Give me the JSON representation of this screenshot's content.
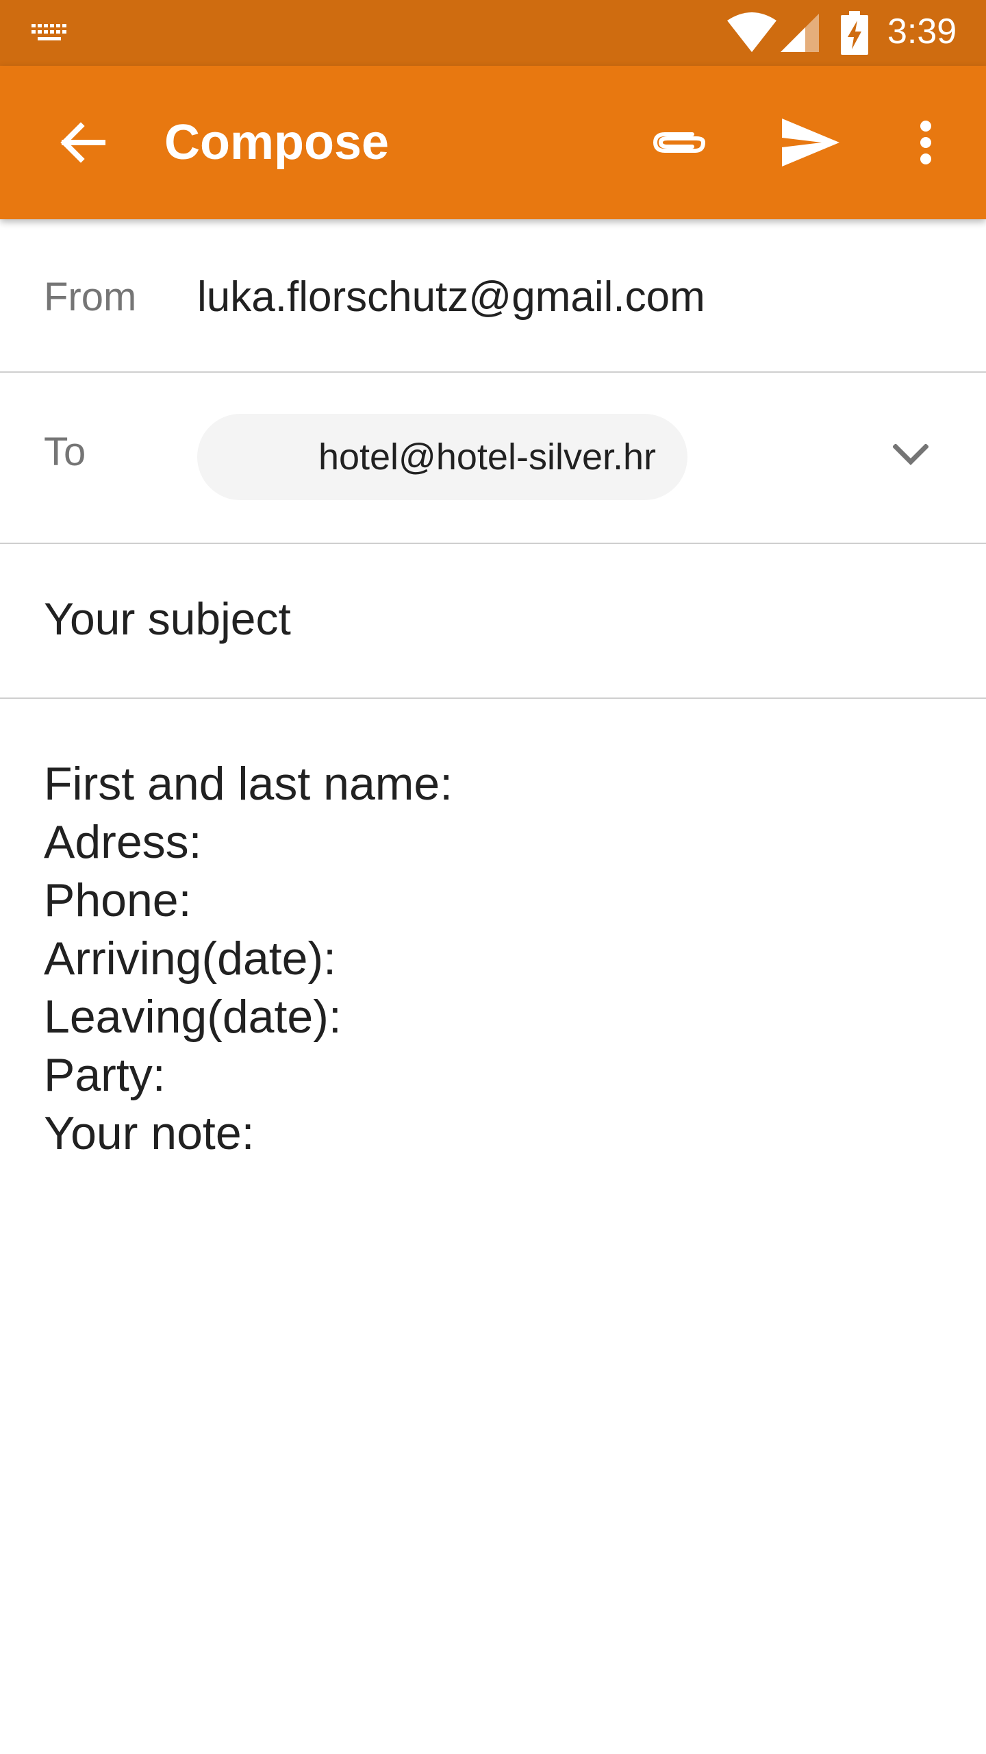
{
  "status_bar": {
    "time": "3:39",
    "icons": [
      "keyboard-icon",
      "wifi-icon",
      "cell-signal-icon",
      "battery-charging-icon"
    ]
  },
  "app_bar": {
    "title": "Compose",
    "icons": [
      "back-arrow-icon",
      "paperclip-icon",
      "send-icon",
      "more-vert-icon"
    ],
    "color": "#e87810",
    "status_color": "#cf6c10"
  },
  "from": {
    "label": "From",
    "value": "luka.florschutz@gmail.com"
  },
  "to": {
    "label": "To",
    "recipient": "hotel@hotel-silver.hr"
  },
  "subject": {
    "value": "Your subject"
  },
  "body": {
    "lines": [
      "First and last name:",
      "Adress:",
      "Phone:",
      "Arriving(date):",
      "Leaving(date):",
      "Party:",
      "Your note:"
    ]
  }
}
